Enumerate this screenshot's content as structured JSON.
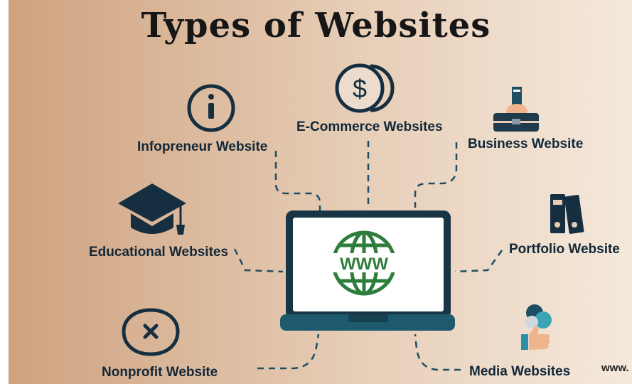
{
  "title": "Types of Websites",
  "center": {
    "screen_text": "WWW"
  },
  "items": [
    {
      "label": "E-Commerce Websites",
      "icon": "dollar-coin-icon"
    },
    {
      "label": "Infopreneur Website",
      "icon": "info-icon"
    },
    {
      "label": "Business Website",
      "icon": "briefcase-hand-icon"
    },
    {
      "label": "Educational Websites",
      "icon": "graduation-cap-icon"
    },
    {
      "label": "Portfolio Website",
      "icon": "binders-icon"
    },
    {
      "label": "Nonprofit Website",
      "icon": "cross-badge-icon"
    },
    {
      "label": "Media Websites",
      "icon": "media-thumbs-up-icon"
    }
  ],
  "watermark": "www.",
  "colors": {
    "navy": "#152f40",
    "teal": "#1d5a6e",
    "green": "#2e7d3c",
    "bg_left": "#cfa27f",
    "bg_right": "#f3e6d8"
  }
}
